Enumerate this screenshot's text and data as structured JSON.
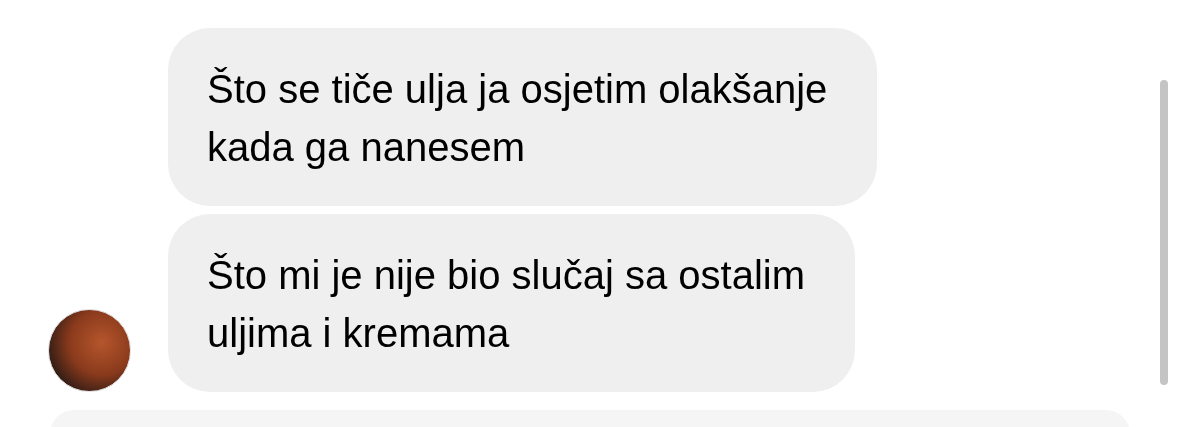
{
  "messages": [
    {
      "lines": [
        "Što se tiče ulja ja osjetim olakšanje",
        "kada ga nanesem"
      ],
      "avatar": false
    },
    {
      "lines": [
        "Što mi je nije bio slučaj sa ostalim",
        "uljima i kremama"
      ],
      "avatar": true
    }
  ]
}
